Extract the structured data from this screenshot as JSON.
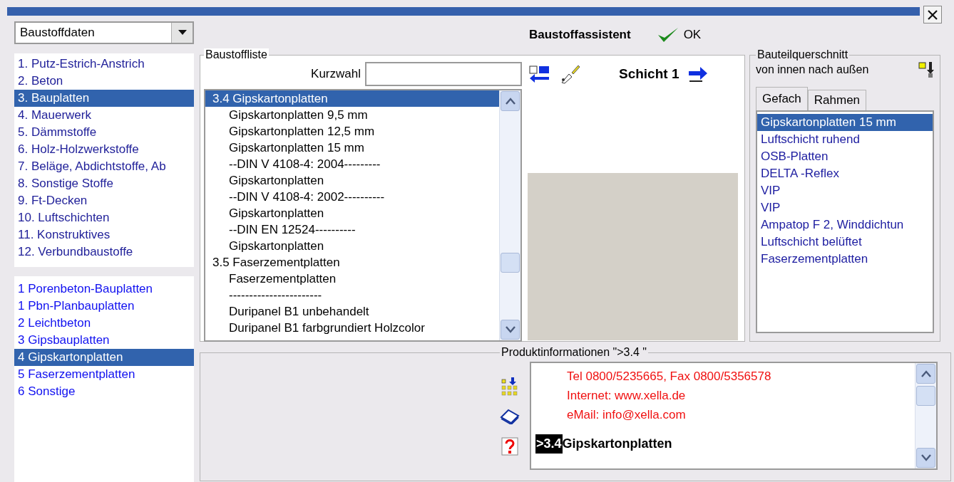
{
  "category_dropdown": {
    "value": "Baustoffdaten"
  },
  "categories": [
    {
      "label": "1. Putz-Estrich-Anstrich",
      "selected": false
    },
    {
      "label": "2. Beton",
      "selected": false
    },
    {
      "label": "3. Bauplatten",
      "selected": true
    },
    {
      "label": "4. Mauerwerk",
      "selected": false
    },
    {
      "label": "5. Dämmstoffe",
      "selected": false
    },
    {
      "label": "6. Holz-Holzwerkstoffe",
      "selected": false
    },
    {
      "label": "7. Beläge, Abdichtstoffe, Ab",
      "selected": false
    },
    {
      "label": "8. Sonstige Stoffe",
      "selected": false
    },
    {
      "label": "9. Ft-Decken",
      "selected": false
    },
    {
      "label": "10. Luftschichten",
      "selected": false
    },
    {
      "label": "11. Konstruktives",
      "selected": false
    },
    {
      "label": "12. Verbundbaustoffe",
      "selected": false
    }
  ],
  "subcategories": [
    {
      "label": "1 Porenbeton-Bauplatten",
      "selected": false
    },
    {
      "label": "1 Pbn-Planbauplatten",
      "selected": false
    },
    {
      "label": "2 Leichtbeton",
      "selected": false
    },
    {
      "label": "3 Gipsbauplatten",
      "selected": false
    },
    {
      "label": "4 Gipskartonplatten",
      "selected": true
    },
    {
      "label": "5 Faserzementplatten",
      "selected": false
    },
    {
      "label": "6 Sonstige",
      "selected": false
    }
  ],
  "header": {
    "title": "Baustoffassistent",
    "ok_button": "OK"
  },
  "material_list": {
    "title": "Baustoffliste",
    "quick_select_label": "Kurzwahl",
    "groups": [
      {
        "label": "3.4 Gipskartonplatten",
        "selected": true,
        "children": [
          {
            "label": "Gipskartonplatten 9,5 mm",
            "selected": false
          },
          {
            "label": "Gipskartonplatten 12,5 mm",
            "selected": false
          },
          {
            "label": "Gipskartonplatten 15 mm",
            "selected": false
          },
          {
            "label": "--DIN V 4108-4: 2004---------",
            "selected": false
          },
          {
            "label": "Gipskartonplatten",
            "selected": false
          },
          {
            "label": "--DIN V 4108-4: 2002----------",
            "selected": false
          },
          {
            "label": "Gipskartonplatten",
            "selected": false
          },
          {
            "label": "--DIN EN 12524----------",
            "selected": false
          },
          {
            "label": "Gipskartonplatten",
            "selected": false
          }
        ]
      },
      {
        "label": "3.5 Faserzementplatten",
        "selected": false,
        "children": [
          {
            "label": "Faserzementplatten",
            "selected": false
          },
          {
            "label": "-----------------------",
            "selected": false
          },
          {
            "label": "Duripanel B1 unbehandelt",
            "selected": false
          },
          {
            "label": "Duripanel B1 farbgrundiert Holzcolor",
            "selected": false
          }
        ]
      }
    ]
  },
  "layer": {
    "label": "Schicht 1"
  },
  "cross_section": {
    "title": "Bauteilquerschnitt",
    "subtitle": "von innen nach außen",
    "tabs": [
      {
        "label": "Gefach",
        "selected": true
      },
      {
        "label": "Rahmen",
        "selected": false
      }
    ],
    "layers": [
      {
        "label": "Gipskartonplatten 15 mm",
        "selected": true
      },
      {
        "label": "Luftschicht ruhend",
        "selected": false
      },
      {
        "label": "OSB-Platten",
        "selected": false
      },
      {
        "label": "DELTA -Reflex",
        "selected": false
      },
      {
        "label": "VIP",
        "selected": false
      },
      {
        "label": "VIP",
        "selected": false
      },
      {
        "label": "Ampatop F 2, Winddichtun",
        "selected": false
      },
      {
        "label": "Luftschicht belüftet",
        "selected": false
      },
      {
        "label": "Faserzementplatten",
        "selected": false
      }
    ]
  },
  "product_info": {
    "title": "Produktinformationen \">3.4 \"",
    "contact_lines": [
      "Tel 0800/5235665, Fax 0800/5356578",
      "Internet: www.xella.de",
      "eMail: info@xella.com"
    ],
    "heading": {
      "code": ">3.4",
      "title": "Gipskartonplatten"
    }
  }
}
